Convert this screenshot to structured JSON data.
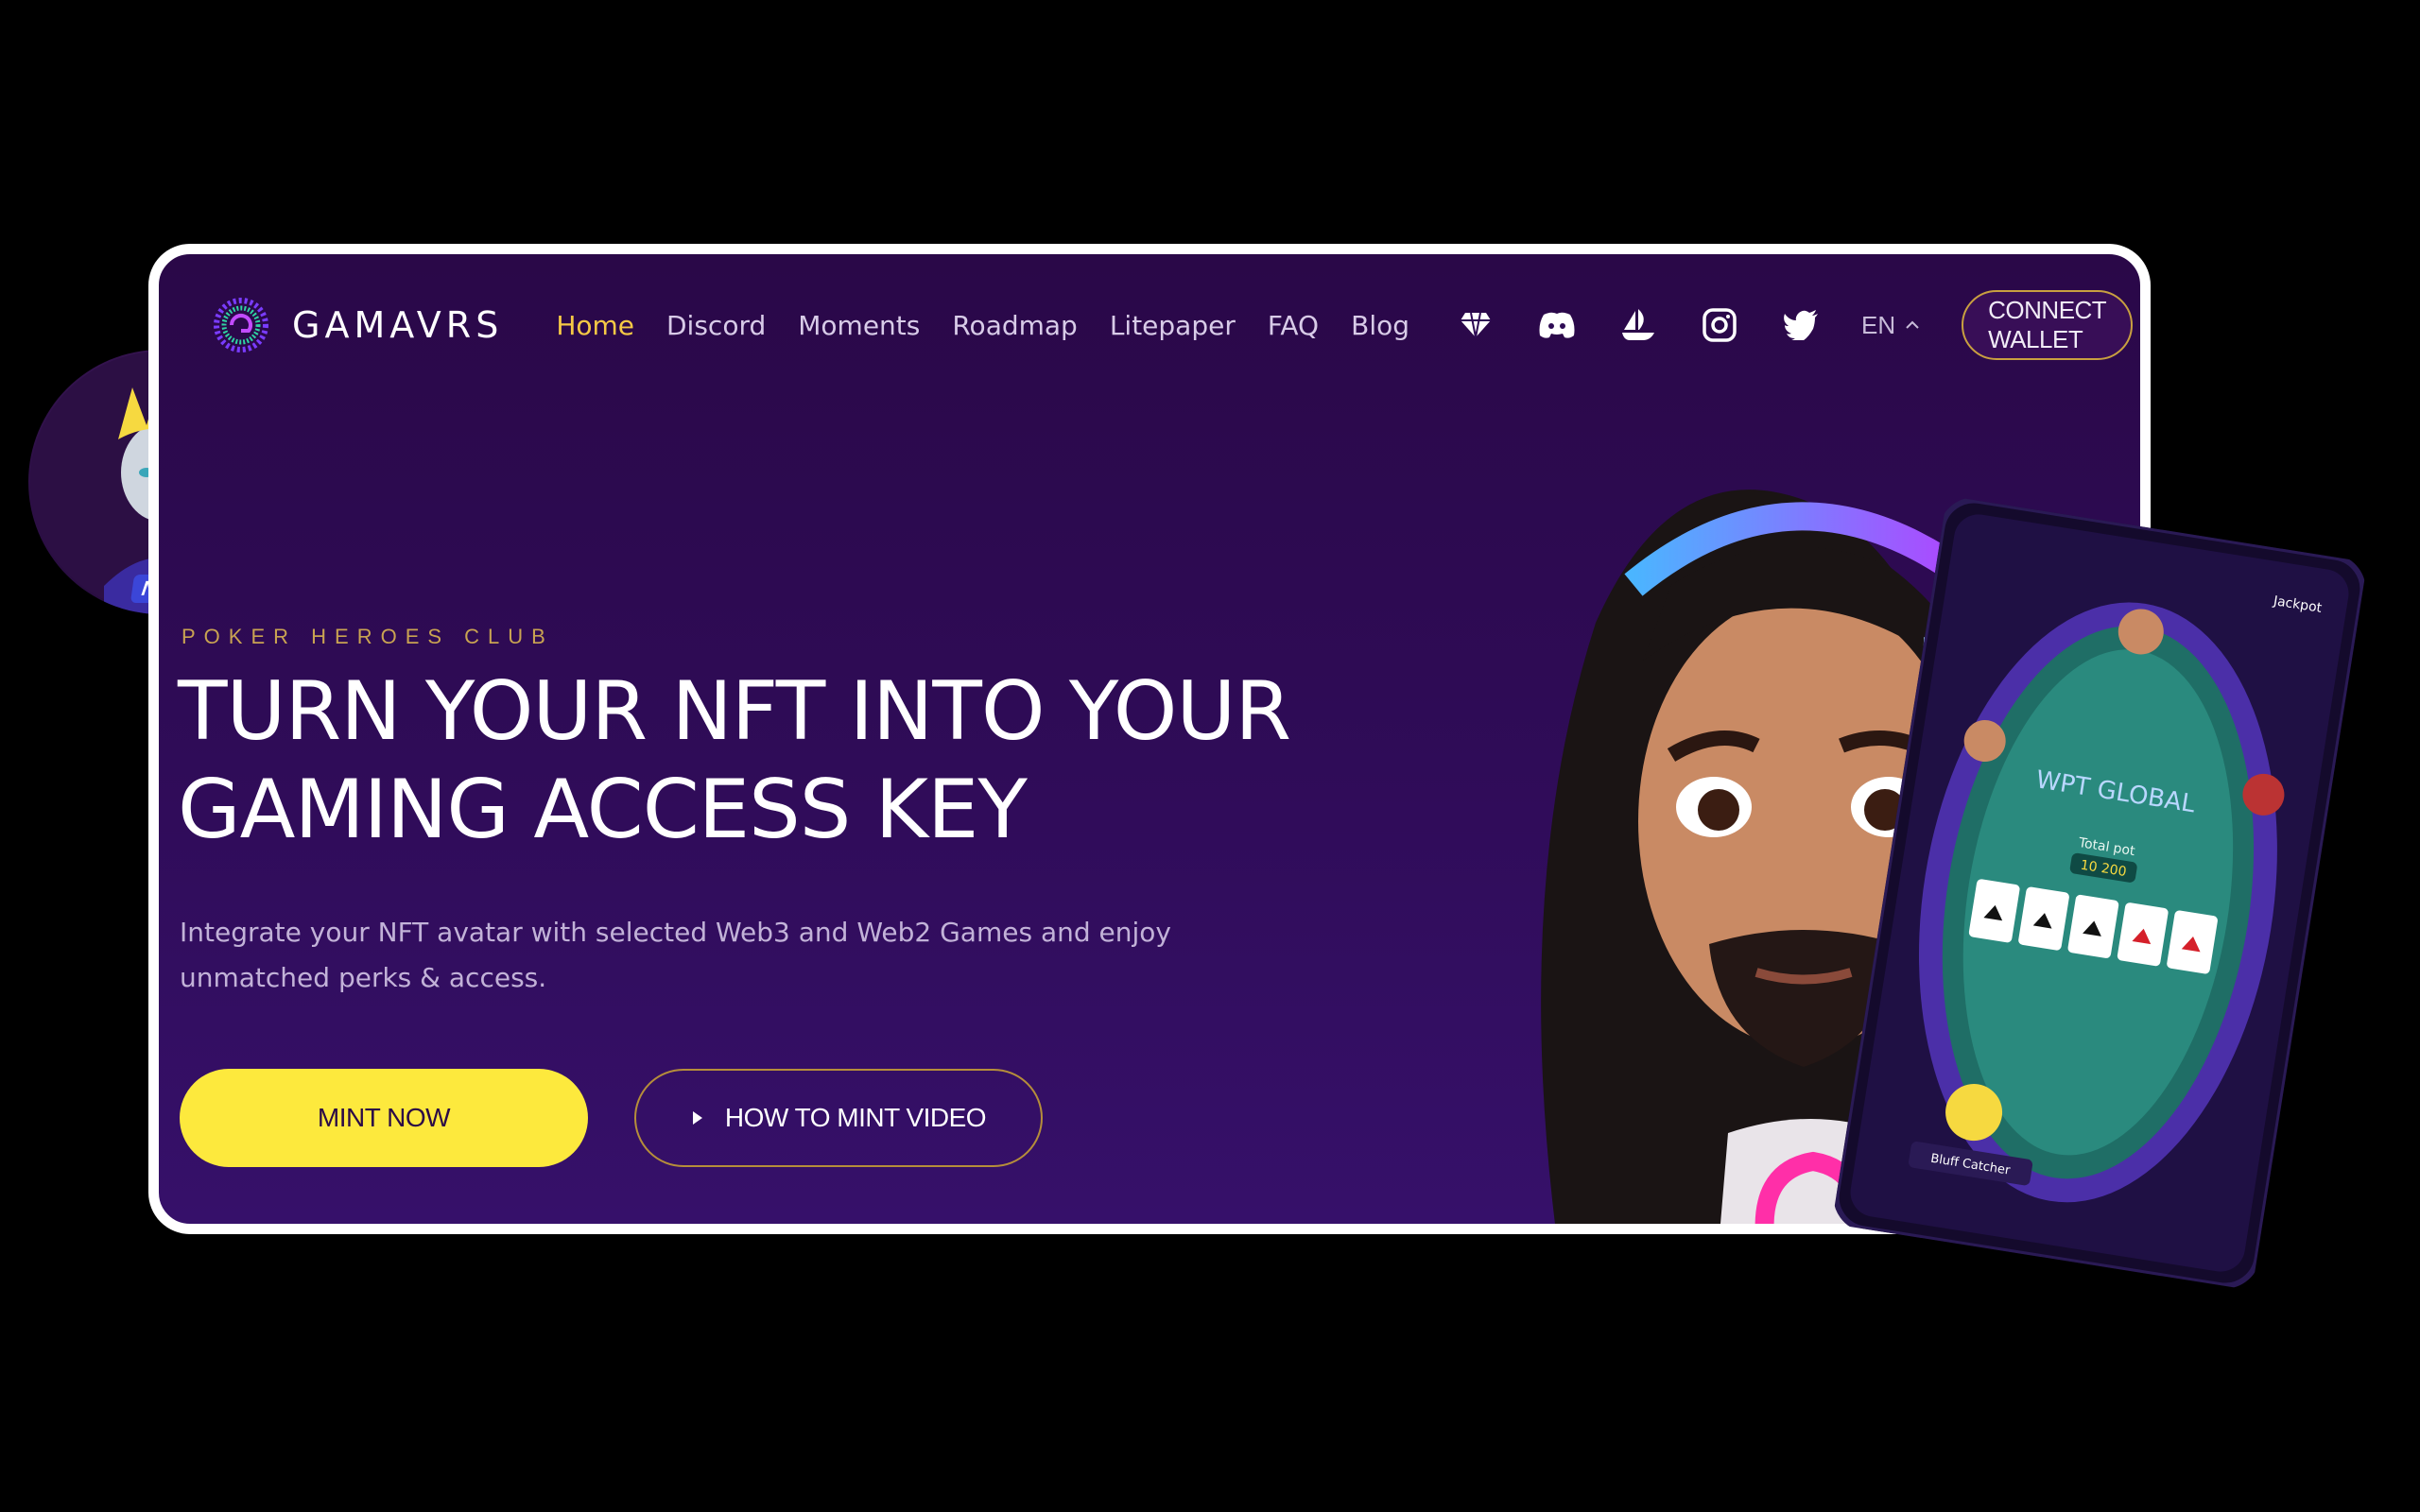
{
  "nav": {
    "brand": "GAMAVRS",
    "items": [
      {
        "label": "Home",
        "active": true
      },
      {
        "label": "Discord",
        "active": false
      },
      {
        "label": "Moments",
        "active": false
      },
      {
        "label": "Roadmap",
        "active": false
      },
      {
        "label": "Litepaper",
        "active": false
      },
      {
        "label": "FAQ",
        "active": false
      },
      {
        "label": "Blog",
        "active": false
      }
    ],
    "social_icons": [
      "gem-icon",
      "discord-icon",
      "opensea-icon",
      "instagram-icon",
      "twitter-icon"
    ],
    "language": "EN",
    "connect_label": "CONNECT WALLET"
  },
  "hero": {
    "eyebrow": "POKER HEROES CLUB",
    "title_line1": "TURN YOUR NFT INTO YOUR",
    "title_line2": "GAMING ACCESS KEY",
    "description": "Integrate your NFT avatar with selected Web3 and Web2 Games and enjoy unmatched perks & access.",
    "mint_label": "MINT NOW",
    "video_label": "HOW TO MINT VIDEO"
  },
  "badge": {
    "label": "NFT"
  },
  "phone": {
    "logo": "WPT GLOBAL",
    "pot_label": "Total pot",
    "pot_value": "10 200",
    "jackpot_label": "Jackpot",
    "player_name": "Bluff Catcher"
  },
  "colors": {
    "accent_yellow": "#fde93d",
    "active_link": "#f6c945",
    "gold_border": "#c9a040",
    "card_bg": "#2e0b55"
  }
}
